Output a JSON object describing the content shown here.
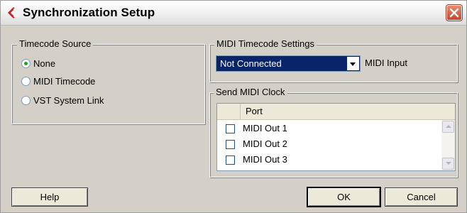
{
  "window": {
    "title": "Synchronization Setup",
    "title_icon": "cubase-logo-icon",
    "close_icon": "close-icon",
    "background": "#d4d0c8"
  },
  "timecode_source": {
    "label": "Timecode Source",
    "options": [
      {
        "label": "None",
        "selected": true
      },
      {
        "label": "MIDI Timecode",
        "selected": false
      },
      {
        "label": "VST System Link",
        "selected": false
      }
    ]
  },
  "midi_timecode_settings": {
    "label": "MIDI Timecode Settings",
    "input_value": "Not Connected",
    "input_caption": "MIDI Input"
  },
  "send_midi_clock": {
    "label": "Send MIDI Clock",
    "column_header": "Port",
    "rows": [
      {
        "label": "MIDI Out 1",
        "checked": false
      },
      {
        "label": "MIDI Out 2",
        "checked": false
      },
      {
        "label": "MIDI Out 3",
        "checked": false
      }
    ]
  },
  "buttons": {
    "help": "Help",
    "ok": "OK",
    "cancel": "Cancel"
  },
  "colors": {
    "selected_field": "#0a246a",
    "radio_dot": "#21a121",
    "logo": "#cc1f1f"
  }
}
